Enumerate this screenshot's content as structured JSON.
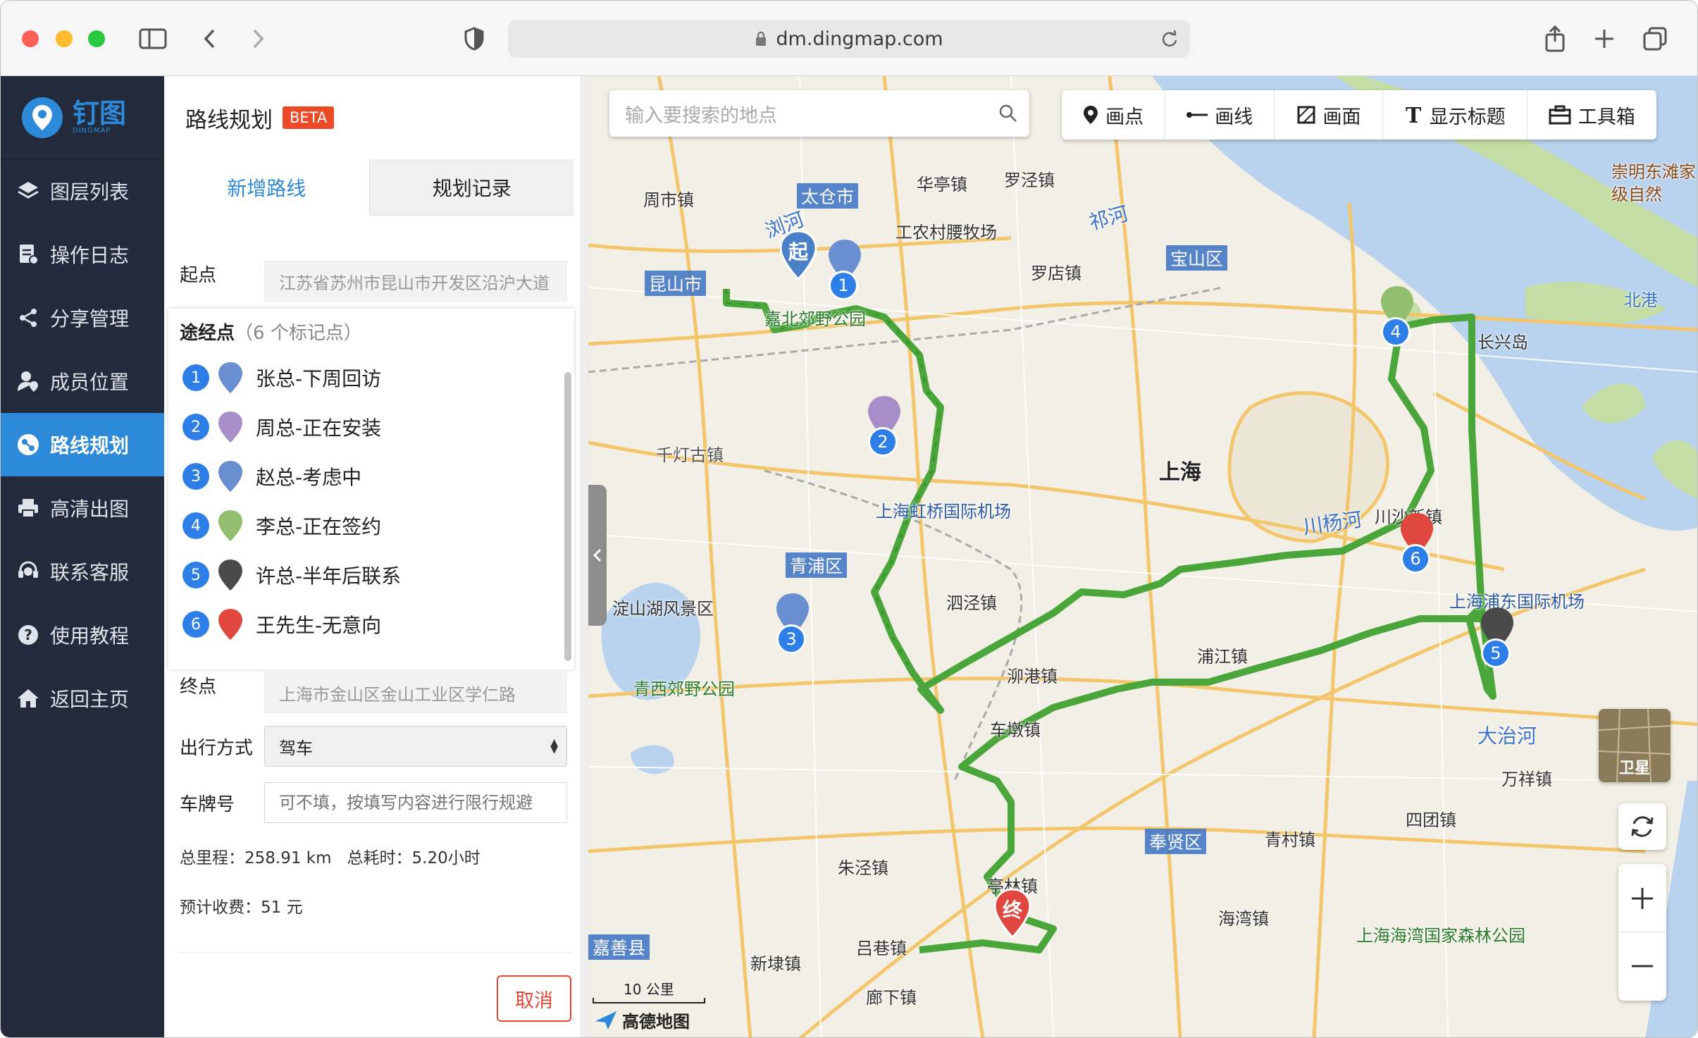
{
  "browser": {
    "url": "dm.dingmap.com"
  },
  "app": {
    "logo_text": "钉图",
    "logo_sub": "DINGMAP"
  },
  "sidebar": {
    "items": [
      {
        "label": "图层列表",
        "icon": "layers-icon"
      },
      {
        "label": "操作日志",
        "icon": "log-icon"
      },
      {
        "label": "分享管理",
        "icon": "share-icon"
      },
      {
        "label": "成员位置",
        "icon": "member-location-icon"
      },
      {
        "label": "路线规划",
        "icon": "route-icon",
        "active": true
      },
      {
        "label": "高清出图",
        "icon": "print-icon"
      },
      {
        "label": "联系客服",
        "icon": "support-icon"
      },
      {
        "label": "使用教程",
        "icon": "help-icon"
      },
      {
        "label": "返回主页",
        "icon": "home-icon"
      }
    ]
  },
  "panel": {
    "title": "路线规划",
    "badge": "BETA",
    "tabs": [
      "新增路线",
      "规划记录"
    ],
    "start_label": "起点",
    "start_value": "江苏省苏州市昆山市开发区沿沪大道",
    "waypoints_label": "途经点",
    "waypoints_count": "（6 个标记点）",
    "waypoints": [
      {
        "num": "1",
        "name": "张总-下周回访",
        "color": "#6a8fd0"
      },
      {
        "num": "2",
        "name": "周总-正在安装",
        "color": "#a88ec8"
      },
      {
        "num": "3",
        "name": "赵总-考虑中",
        "color": "#6a8fd0"
      },
      {
        "num": "4",
        "name": "李总-正在签约",
        "color": "#92bf6e"
      },
      {
        "num": "5",
        "name": "许总-半年后联系",
        "color": "#4a4a4a"
      },
      {
        "num": "6",
        "name": "王先生-无意向",
        "color": "#e0473e"
      }
    ],
    "end_label": "终点",
    "end_value": "上海市金山区金山工业区学仁路",
    "travel_label": "出行方式",
    "travel_value": "驾车",
    "plate_label": "车牌号",
    "plate_placeholder": "可不填，按填写内容进行限行规避",
    "distance": "总里程：258.91 km",
    "duration": "总耗时：5.20小时",
    "toll": "预计收费：51 元",
    "cancel": "取消"
  },
  "map": {
    "search_placeholder": "输入要搜索的地点",
    "tools": [
      {
        "label": "画点",
        "icon": "pin-icon"
      },
      {
        "label": "画线",
        "icon": "line-icon"
      },
      {
        "label": "画面",
        "icon": "polygon-icon"
      },
      {
        "label": "显示标题",
        "icon": "title-icon"
      },
      {
        "label": "工具箱",
        "icon": "toolbox-icon"
      }
    ],
    "satellite_label": "卫星",
    "scale": "10 公里",
    "provider": "高德地图",
    "start_marker": "起",
    "end_marker": "终",
    "labels": {
      "shanghai": "上海",
      "taicang": "太仓市",
      "kunshan": "昆山市",
      "liuhe": "浏河",
      "baoshan": "宝山区",
      "qingpu": "青浦区",
      "hongqiao": "上海虹桥国际机场",
      "pudong_airport": "上海浦东国际机场",
      "chuanyang": "川杨河",
      "dazhi": "大治河",
      "fengxian": "奉贤区",
      "jiashan": "嘉善县",
      "changxing": "长兴岛",
      "beigang": "北港",
      "qiandeng": "千灯古镇",
      "dianshan": "淀山湖风景区",
      "qingxi": "青西郊野公园",
      "haiwan_park": "上海海湾国家森林公园",
      "chongming": "崇明东滩家级自然",
      "huating": "华亭镇",
      "luojing": "罗泾镇",
      "luodian": "罗店镇",
      "gongnong": "工农村腰牧场",
      "zhouxi": "周市镇",
      "jiabei": "嘉北郊野公园",
      "sijing": "泗泾镇",
      "pujiang": "浦江镇",
      "chuansha": "川沙新镇",
      "wanxiang": "万祥镇",
      "situan": "四团镇",
      "qingcun": "青村镇",
      "haiwan": "海湾镇",
      "tinglin": "亭林镇",
      "zhujing": "朱泾镇",
      "lvxiang": "吕巷镇",
      "xindai": "新埭镇",
      "liaoxia": "廊下镇",
      "chedun": "车墩镇",
      "qiqiao": "泖港镇",
      "jiangqiao": "祁河"
    }
  }
}
